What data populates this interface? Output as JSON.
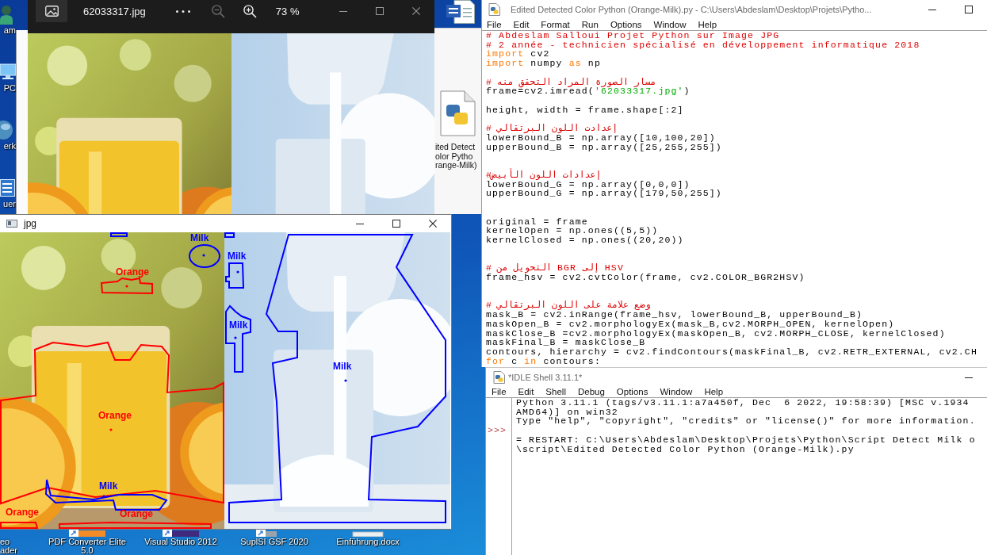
{
  "desktop": {
    "side_icons": [
      {
        "kind": "person",
        "label": "am"
      },
      {
        "kind": "monitor",
        "label": "PC"
      },
      {
        "kind": "globe",
        "label": "erk"
      },
      {
        "kind": "panel",
        "label": "uer"
      }
    ],
    "file_icon": {
      "lines": [
        "ited Detect",
        "olor Pytho",
        "range-Milk)"
      ]
    },
    "bottom_icons": [
      {
        "kind": "label",
        "lines": [
          "eo",
          "ader"
        ]
      },
      {
        "kind": "pdf",
        "lines": [
          "PDF Converter Elite",
          "5.0"
        ]
      },
      {
        "kind": "studio",
        "lines": [
          "Visual Studio 2012"
        ]
      },
      {
        "kind": "shortcut",
        "lines": [
          "SuplSI GSF 2020"
        ]
      },
      {
        "kind": "document",
        "lines": [
          "Einführung.docx"
        ]
      }
    ]
  },
  "photo_viewer": {
    "file_name": "62033317.jpg",
    "zoom_out": {
      "disabled": true
    },
    "zoom_in": {
      "disabled": false
    },
    "zoom": "73 %"
  },
  "editor": {
    "title": "Edited Detected Color Python (Orange-Milk).py - C:\\Users\\Abdeslam\\Desktop\\Projets\\Pytho...",
    "menu": [
      "File",
      "Edit",
      "Format",
      "Run",
      "Options",
      "Window",
      "Help"
    ],
    "lines": [
      {
        "kind": "code",
        "tokens": [
          {
            "kind": "comment",
            "text": "# Abdeslam Salloui Projet Python sur Image JPG"
          }
        ]
      },
      {
        "kind": "code",
        "tokens": [
          {
            "kind": "comment",
            "text": "# 2 année - technicien spécialisé en développement informatique 2018"
          }
        ]
      },
      {
        "kind": "code",
        "tokens": [
          {
            "kind": "keyword",
            "text": "import"
          },
          {
            "kind": "plain",
            "text": " cv2"
          }
        ]
      },
      {
        "kind": "code",
        "tokens": [
          {
            "kind": "keyword",
            "text": "import"
          },
          {
            "kind": "plain",
            "text": " numpy "
          },
          {
            "kind": "keyword",
            "text": "as"
          },
          {
            "kind": "plain",
            "text": " np"
          }
        ]
      },
      {
        "kind": "blank"
      },
      {
        "kind": "code",
        "tokens": [
          {
            "kind": "comment",
            "text": "# مسار الصورة المراد التحقق منه"
          }
        ]
      },
      {
        "kind": "code",
        "tokens": [
          {
            "kind": "plain",
            "text": "frame=cv2.imread("
          },
          {
            "kind": "string",
            "text": "'62033317.jpg'"
          },
          {
            "kind": "plain",
            "text": ")"
          }
        ]
      },
      {
        "kind": "blank"
      },
      {
        "kind": "code",
        "tokens": [
          {
            "kind": "plain",
            "text": "height, width = frame.shape[:2]"
          }
        ]
      },
      {
        "kind": "blank"
      },
      {
        "kind": "code",
        "tokens": [
          {
            "kind": "comment",
            "text": "# إعدادت اللون البرتقالي"
          }
        ]
      },
      {
        "kind": "code",
        "tokens": [
          {
            "kind": "plain",
            "text": "lowerBound_B = np.array([10,100,20])"
          }
        ]
      },
      {
        "kind": "code",
        "tokens": [
          {
            "kind": "plain",
            "text": "upperBound_B = np.array([25,255,255])"
          }
        ]
      },
      {
        "kind": "blank"
      },
      {
        "kind": "blank"
      },
      {
        "kind": "code",
        "tokens": [
          {
            "kind": "comment",
            "text": "#إعدادات اللون الأبيض"
          }
        ]
      },
      {
        "kind": "code",
        "tokens": [
          {
            "kind": "plain",
            "text": "lowerBound_G = np.array([0,0,0])"
          }
        ]
      },
      {
        "kind": "code",
        "tokens": [
          {
            "kind": "plain",
            "text": "upperBound_G = np.array([179,50,255])"
          }
        ]
      },
      {
        "kind": "blank"
      },
      {
        "kind": "blank"
      },
      {
        "kind": "code",
        "tokens": [
          {
            "kind": "plain",
            "text": "original = frame"
          }
        ]
      },
      {
        "kind": "code",
        "tokens": [
          {
            "kind": "plain",
            "text": "kernelOpen = np.ones((5,5))"
          }
        ]
      },
      {
        "kind": "code",
        "tokens": [
          {
            "kind": "plain",
            "text": "kernelClosed = np.ones((20,20))"
          }
        ]
      },
      {
        "kind": "blank"
      },
      {
        "kind": "blank"
      },
      {
        "kind": "code",
        "tokens": [
          {
            "kind": "comment",
            "text": "# التحويل من BGR إلى HSV"
          }
        ]
      },
      {
        "kind": "code",
        "tokens": [
          {
            "kind": "plain",
            "text": "frame_hsv = cv2.cvtColor(frame, cv2.COLOR_BGR2HSV)"
          }
        ]
      },
      {
        "kind": "blank"
      },
      {
        "kind": "blank"
      },
      {
        "kind": "code",
        "tokens": [
          {
            "kind": "comment",
            "text": "# وضع علامة على اللون البرتقالي"
          }
        ]
      },
      {
        "kind": "code",
        "tokens": [
          {
            "kind": "plain",
            "text": "mask_B = cv2.inRange(frame_hsv, lowerBound_B, upperBound_B)"
          }
        ]
      },
      {
        "kind": "code",
        "tokens": [
          {
            "kind": "plain",
            "text": "maskOpen_B = cv2.morphologyEx(mask_B,cv2.MORPH_OPEN, kernelOpen)"
          }
        ]
      },
      {
        "kind": "code",
        "tokens": [
          {
            "kind": "plain",
            "text": "maskClose_B =cv2.morphologyEx(maskOpen_B, cv2.MORPH_CLOSE, kernelClosed)"
          }
        ]
      },
      {
        "kind": "code",
        "tokens": [
          {
            "kind": "plain",
            "text": "maskFinal_B = maskClose_B"
          }
        ]
      },
      {
        "kind": "code",
        "tokens": [
          {
            "kind": "plain",
            "text": "contours, hierarchy = cv2.findContours(maskFinal_B, cv2.RETR_EXTERNAL, cv2.CH"
          }
        ]
      },
      {
        "kind": "code",
        "tokens": [
          {
            "kind": "keyword",
            "text": "for"
          },
          {
            "kind": "plain",
            "text": " c "
          },
          {
            "kind": "keyword",
            "text": "in"
          },
          {
            "kind": "plain",
            "text": " contours:"
          }
        ]
      }
    ]
  },
  "shell": {
    "title": "*IDLE Shell 3.11.1*",
    "menu": [
      "File",
      "Edit",
      "Shell",
      "Debug",
      "Options",
      "Window",
      "Help"
    ],
    "output_lines": [
      "Python 3.11.1 (tags/v3.11.1:a7a450f, Dec  6 2022, 19:58:39) [MSC v.1934",
      "AMD64)] on win32",
      "Type \"help\", \"copyright\", \"credits\" or \"license()\" for more information."
    ],
    "prompt": ">>>",
    "restart_lines": [
      "= RESTART: C:\\Users\\Abdeslam\\Desktop\\Projets\\Python\\Script Detect Milk o",
      "\\script\\Edited Detected Color Python (Orange-Milk).py"
    ]
  },
  "image_window": {
    "title": "jpg",
    "detections": [
      {
        "color": "#0000ff"
      },
      {
        "label": "Milk",
        "color": "#0000ff"
      },
      {
        "label": "Orange",
        "color": "#ff0000"
      },
      {
        "label": "Orange",
        "color": "#ff0000"
      },
      {
        "label": "Milk",
        "color": "#0000ff"
      },
      {
        "label": "Orange",
        "color": "#ff0000"
      },
      {
        "label": "Orange",
        "color": "#ff0000"
      },
      {
        "color": "#0000ff"
      },
      {
        "label": "Milk",
        "color": "#0000ff"
      },
      {
        "label": "Milk",
        "color": "#0000ff"
      },
      {
        "label": "Milk",
        "color": "#0000ff"
      }
    ]
  }
}
